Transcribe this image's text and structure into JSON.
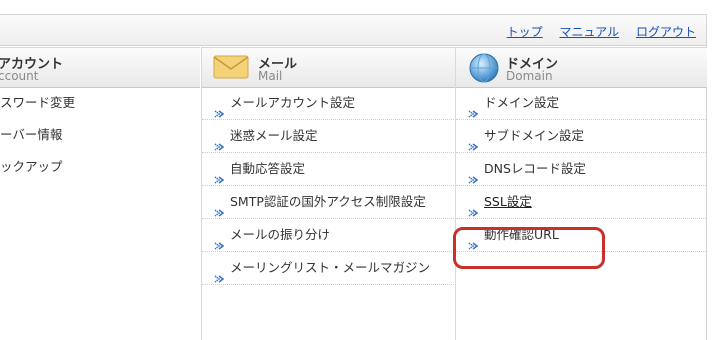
{
  "header": {
    "links": [
      "トップ",
      "マニュアル",
      "ログアウト"
    ]
  },
  "columns": [
    {
      "title": "アカウント",
      "subtitle": "ccount",
      "icon": "account-icon",
      "items": [
        "スワード変更",
        "ーバー情報",
        "ックアップ"
      ]
    },
    {
      "title": "メール",
      "subtitle": "Mail",
      "icon": "envelope-icon",
      "items": [
        "メールアカウント設定",
        "迷惑メール設定",
        "自動応答設定",
        "SMTP認証の国外アクセス制限設定",
        "メールの振り分け",
        "メーリングリスト・メールマガジン"
      ]
    },
    {
      "title": "ドメイン",
      "subtitle": "Domain",
      "icon": "globe-icon",
      "items": [
        "ドメイン設定",
        "サブドメイン設定",
        "DNSレコード設定",
        "SSL設定",
        "動作確認URL"
      ]
    }
  ],
  "highlighted_item": "SSL設定",
  "colors": {
    "link": "#1a4fb5",
    "highlight": "#c9302c",
    "arrow": "#3a73c8"
  }
}
